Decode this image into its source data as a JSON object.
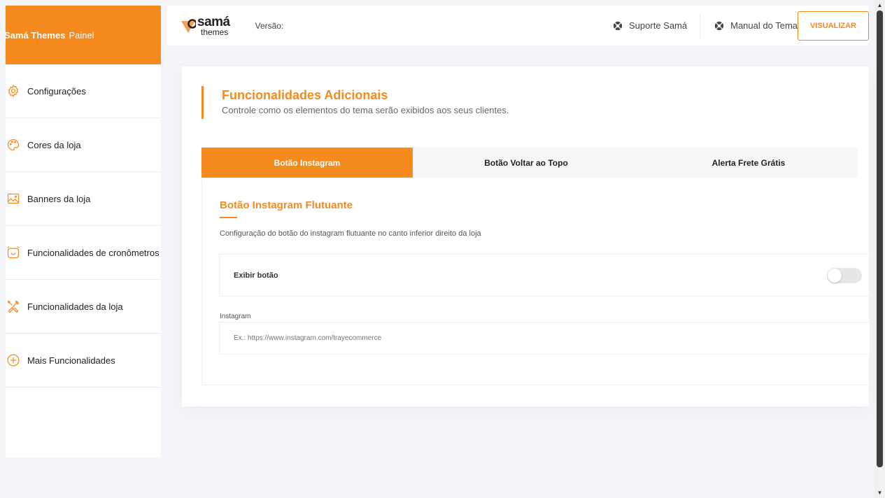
{
  "brand": {
    "bold": "Samá Themes",
    "regular": "Painel",
    "color": "#f58a1f"
  },
  "sidebar": {
    "items": [
      {
        "label": "Configurações",
        "icon": "gear-icon"
      },
      {
        "label": "Cores da loja",
        "icon": "palette-icon"
      },
      {
        "label": "Banners da loja",
        "icon": "image-icon"
      },
      {
        "label": "Funcionalidades de cronômetros",
        "icon": "alarm-clock-icon"
      },
      {
        "label": "Funcionalidades da loja",
        "icon": "tools-icon"
      },
      {
        "label": "Mais Funcionalidades",
        "icon": "plus-circle-icon"
      }
    ]
  },
  "topbar": {
    "logo_line1": "samá",
    "logo_line2": "themes",
    "version_label": "Versão:",
    "support_label": "Suporte Samá",
    "manual_label": "Manual do Tema",
    "view_button": "VISUALIZAR"
  },
  "main": {
    "title": "Funcionalidades Adicionais",
    "subtitle": "Controle como os elementos do tema serão exibidos aos seus clientes.",
    "tabs": [
      {
        "label": "Botão Instagram",
        "active": true
      },
      {
        "label": "Botão Voltar ao Topo",
        "active": false
      },
      {
        "label": "Alerta Frete Grátis",
        "active": false
      }
    ],
    "panel": {
      "title": "Botão Instagram Flutuante",
      "description": "Configuração do botão do instagram flutuante no canto inferior direito da loja",
      "toggle_label": "Exibir botão",
      "toggle_on": false,
      "field_label": "Instagram",
      "field_placeholder": "Ex.: https://www.instagram.com/trayecommerce",
      "field_value": ""
    }
  }
}
